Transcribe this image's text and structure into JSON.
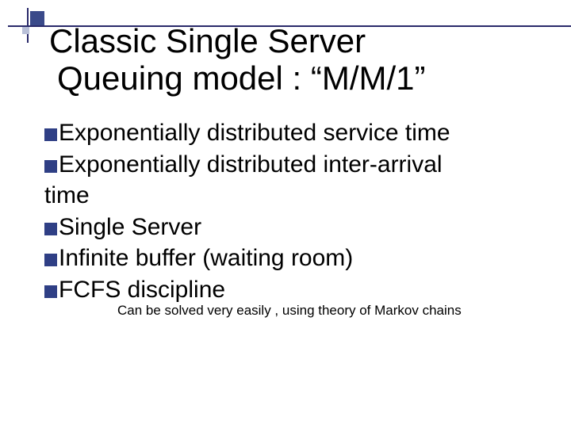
{
  "title_line1": "Classic Single Server",
  "title_line2": "Queuing model : “M/M/1”",
  "bullets": {
    "b1": "Exponentially distributed service time",
    "b2": "Exponentially distributed inter-arrival",
    "b2_cont": "time",
    "b3": "Single Server",
    "b4": "Infinite buffer (waiting room)",
    "b5": "FCFS discipline"
  },
  "subnote": "Can be solved very easily , using theory of Markov chains"
}
